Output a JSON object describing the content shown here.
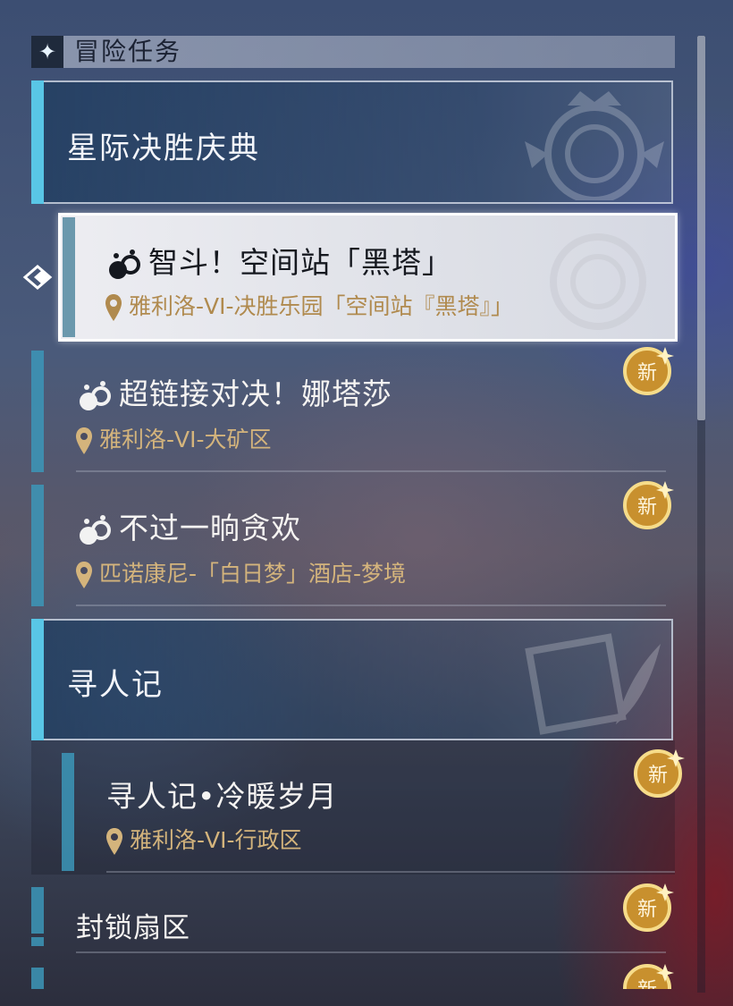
{
  "panel": {
    "title": "冒险任务",
    "title_icon": "four-point-star-icon"
  },
  "categories": [
    {
      "label": "星际决胜庆典"
    },
    {
      "label": "寻人记"
    }
  ],
  "quests": [
    {
      "title": "智斗！空间站「黑塔」",
      "location": "雅利洛-VI-决胜乐园「空间站『黑塔』」",
      "selected": true
    },
    {
      "title": "超链接对决！娜塔莎",
      "location": "雅利洛-VI-大矿区",
      "new": "新"
    },
    {
      "title": "不过一晌贪欢",
      "location": "匹诺康尼-「白日梦」酒店-梦境",
      "new": "新"
    },
    {
      "title": "寻人记•冷暖岁月",
      "location": "雅利洛-VI-行政区",
      "new": "新"
    },
    {
      "title": "封锁扇区",
      "new": "新"
    },
    {
      "new": "新"
    }
  ],
  "colors": {
    "accent": "#59c6e6",
    "location_text": "#d4b47c",
    "badge": "#c8902e"
  }
}
